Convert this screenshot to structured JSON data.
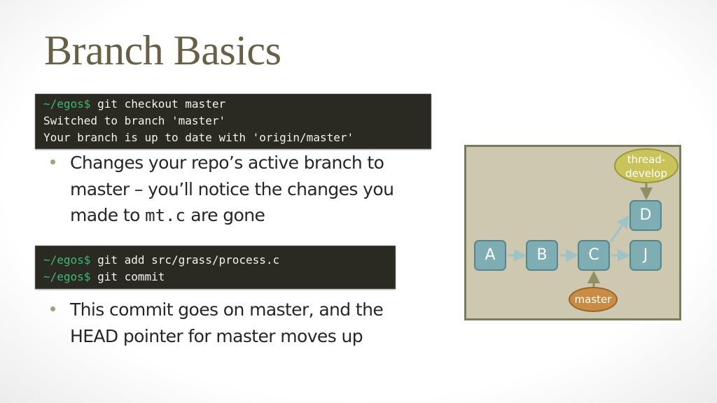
{
  "slide": {
    "title": "Branch Basics"
  },
  "terminal1": {
    "lines": [
      {
        "prompt": "~/egos$ ",
        "text": "git checkout master"
      },
      {
        "prompt": "",
        "text": "Switched to branch 'master'"
      },
      {
        "prompt": "",
        "text": "Your branch is up to date with 'origin/master'"
      }
    ]
  },
  "bullet1": {
    "text_before": "Changes your repo’s active branch to master – you’ll notice the changes you made to ",
    "code": "mt.c",
    "text_after": " are gone"
  },
  "terminal2": {
    "lines": [
      {
        "prompt": "~/egos$ ",
        "text": "git add src/grass/process.c"
      },
      {
        "prompt": "~/egos$ ",
        "text": "git commit"
      }
    ]
  },
  "bullet2": {
    "text": "This commit goes on master, and the HEAD pointer for master moves up"
  },
  "diagram": {
    "commits": [
      "A",
      "B",
      "C",
      "D",
      "J"
    ],
    "edges": [
      [
        "A",
        "B"
      ],
      [
        "B",
        "C"
      ],
      [
        "C",
        "D"
      ],
      [
        "C",
        "J"
      ]
    ],
    "branches": [
      {
        "name_line1": "thread-",
        "name_line2": "develop",
        "points_to": "D",
        "color": "#c8c45b"
      },
      {
        "name": "master",
        "points_to": "C",
        "color": "#c98c45"
      }
    ],
    "colors": {
      "background": "#cdc8af",
      "commit": "#7eaeb4",
      "arrow": "#9fc3c4",
      "pointer_arrow": "#8e8f62"
    }
  }
}
